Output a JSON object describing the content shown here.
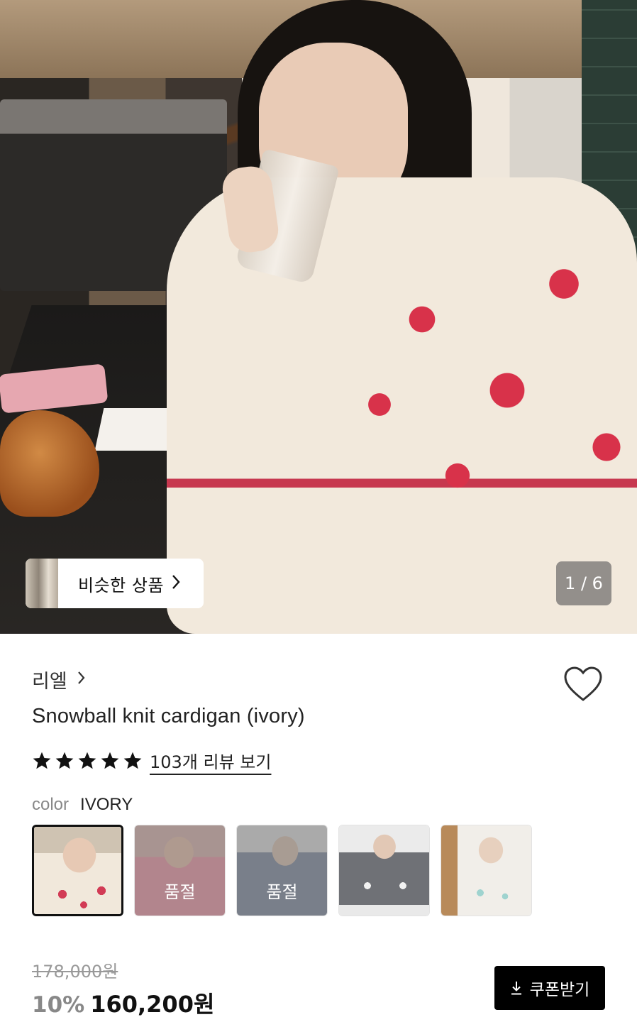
{
  "hero": {
    "image_alt": "woman in ivory snowflake knit cardigan drinking from a glass at a cafe counter",
    "similar_label": "비슷한 상품",
    "page_indicator": "1 / 6"
  },
  "product": {
    "brand": "리엘",
    "title": "Snowball knit cardigan (ivory)",
    "rating_stars": 5,
    "review_link": "103개 리뷰 보기",
    "color_label": "color",
    "color_value": "IVORY",
    "swatches": [
      {
        "name": "ivory",
        "selected": true,
        "sold_out": false,
        "badge": ""
      },
      {
        "name": "pink",
        "selected": false,
        "sold_out": true,
        "badge": "품절"
      },
      {
        "name": "grey",
        "selected": false,
        "sold_out": true,
        "badge": "품절"
      },
      {
        "name": "charcoal",
        "selected": false,
        "sold_out": false,
        "badge": ""
      },
      {
        "name": "mint",
        "selected": false,
        "sold_out": false,
        "badge": ""
      }
    ]
  },
  "price": {
    "original": "178,000원",
    "discount": "10%",
    "sale": "160,200원"
  },
  "coupon": {
    "label": "쿠폰받기",
    "icon": "download-icon"
  },
  "colors": {
    "star": "#111111",
    "button_bg": "#000000",
    "soldout_text": "#ffffff"
  }
}
